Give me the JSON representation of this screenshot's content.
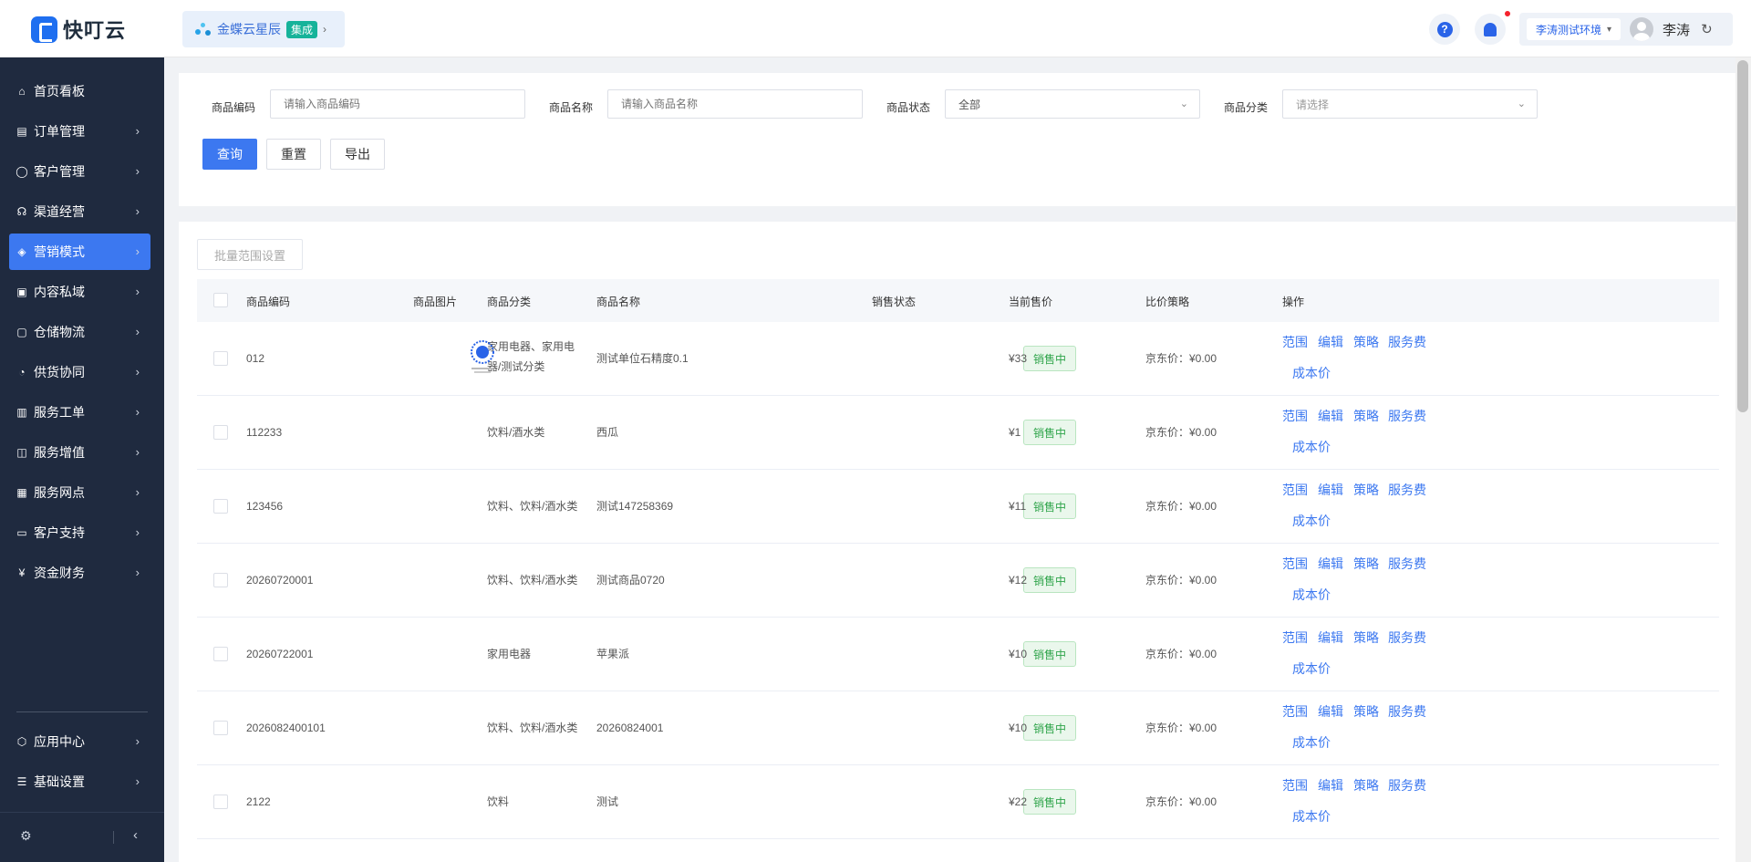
{
  "app": {
    "logo_text": "快叮云",
    "integration": {
      "name": "金蝶云星辰",
      "tag": "集成"
    },
    "env": "李涛测试环境",
    "user_name": "李涛"
  },
  "sidebar": {
    "items": [
      {
        "icon": "home-icon",
        "label": "首页看板",
        "chevron": false
      },
      {
        "icon": "order-icon",
        "label": "订单管理",
        "chevron": true
      },
      {
        "icon": "customer-icon",
        "label": "客户管理",
        "chevron": true
      },
      {
        "icon": "channel-icon",
        "label": "渠道经营",
        "chevron": true
      },
      {
        "icon": "marketing-icon",
        "label": "营销模式",
        "chevron": true,
        "active": true
      },
      {
        "icon": "content-icon",
        "label": "内容私域",
        "chevron": true
      },
      {
        "icon": "warehouse-icon",
        "label": "仓储物流",
        "chevron": true
      },
      {
        "icon": "supply-icon",
        "label": "供货协同",
        "chevron": true
      },
      {
        "icon": "ticket-icon",
        "label": "服务工单",
        "chevron": true
      },
      {
        "icon": "value-added-icon",
        "label": "服务增值",
        "chevron": true
      },
      {
        "icon": "store-icon",
        "label": "服务网点",
        "chevron": true
      },
      {
        "icon": "support-icon",
        "label": "客户支持",
        "chevron": true
      },
      {
        "icon": "finance-icon",
        "label": "资金财务",
        "chevron": true
      }
    ],
    "bottom_items": [
      {
        "icon": "app-center-icon",
        "label": "应用中心"
      },
      {
        "icon": "settings-list-icon",
        "label": "基础设置"
      }
    ]
  },
  "filters": {
    "code_label": "商品编码",
    "code_placeholder": "请输入商品编码",
    "name_label": "商品名称",
    "name_placeholder": "请输入商品名称",
    "status_label": "商品状态",
    "status_value": "全部",
    "category_label": "商品分类",
    "category_placeholder": "请选择",
    "query_btn": "查询",
    "reset_btn": "重置",
    "export_btn": "导出"
  },
  "table": {
    "batch_btn": "批量范围设置",
    "columns": [
      "商品编码",
      "商品图片",
      "商品分类",
      "商品名称",
      "销售状态",
      "当前售价",
      "比价策略",
      "操作"
    ],
    "ops": [
      "范围",
      "编辑",
      "策略",
      "服务费",
      "成本价"
    ],
    "rows": [
      {
        "code": "012",
        "has_image": true,
        "category": "家用电器、家用电器/测试分类",
        "name": "测试单位石精度0.1",
        "status": "销售中",
        "price": "¥33",
        "strategy": "京东价：¥0.00"
      },
      {
        "code": "112233",
        "has_image": false,
        "category": "饮料/酒水类",
        "name": "西瓜",
        "status": "销售中",
        "price": "¥1",
        "strategy": "京东价：¥0.00"
      },
      {
        "code": "123456",
        "has_image": false,
        "category": "饮料、饮料/酒水类",
        "name": "测试147258369",
        "status": "销售中",
        "price": "¥11",
        "strategy": "京东价：¥0.00"
      },
      {
        "code": "20260720001",
        "has_image": false,
        "category": "饮料、饮料/酒水类",
        "name": "测试商品0720",
        "status": "销售中",
        "price": "¥12",
        "strategy": "京东价：¥0.00"
      },
      {
        "code": "20260722001",
        "has_image": false,
        "category": "家用电器",
        "name": "苹果派",
        "status": "销售中",
        "price": "¥10",
        "strategy": "京东价：¥0.00"
      },
      {
        "code": "2026082400101",
        "has_image": false,
        "category": "饮料、饮料/酒水类",
        "name": "20260824001",
        "status": "销售中",
        "price": "¥10",
        "strategy": "京东价：¥0.00"
      },
      {
        "code": "2122",
        "has_image": false,
        "category": "饮料",
        "name": "测试",
        "status": "销售中",
        "price": "¥22",
        "strategy": "京东价：¥0.00"
      }
    ]
  }
}
